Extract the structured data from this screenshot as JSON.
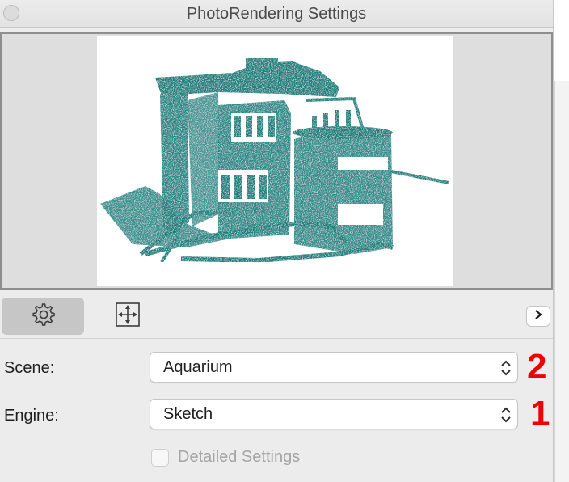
{
  "window": {
    "title": "PhotoRendering Settings"
  },
  "preview": {
    "accent_color": "#12807e"
  },
  "toolbar": {
    "settings_icon": "gear-icon",
    "resize_icon": "resize-arrows-icon",
    "next_icon": "chevron-right-icon"
  },
  "form": {
    "scene": {
      "label": "Scene:",
      "value": "Aquarium",
      "badge": "2"
    },
    "engine": {
      "label": "Engine:",
      "value": "Sketch",
      "badge": "1"
    },
    "detailed": {
      "label": "Detailed Settings",
      "checked": false
    }
  }
}
